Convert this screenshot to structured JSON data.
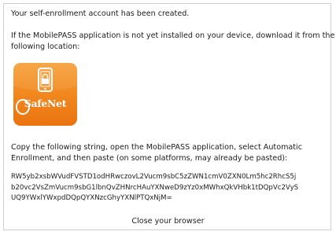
{
  "messages": {
    "created": "Your self-enrollment account has been created.",
    "install_line1": "If the MobilePASS application is not yet installed on your device, download it from the",
    "install_line2": "following location:",
    "copy_line1": "Copy the following string, open the MobilePASS application, select Automatic",
    "copy_line2": "Enrollment, and then paste (on some platforms, may already be pasted):"
  },
  "app_icon": {
    "brand_text": "SafeNet",
    "icon": "mobile-phone-lock-icon",
    "colors": {
      "top": "#f7a039",
      "bottom": "#ea7310",
      "glyph": "#ffffff"
    }
  },
  "enrollment_string": {
    "line1": "RW5yb2xsbWVudFVSTD1odHRwczovL2Vucm9sbC5zZWN1cmV0ZXN0Lm5hc2RhcS5j",
    "line2": "b20vc2VsZmVucm9sbG1lbnQvZHNrcHAuYXNweD9zYz0xMWhxQkVHbk1tDQpVc2VyS",
    "line3": "UQ9YWxlYWxpdDQpQYXNzcGhyYXNlPTQxNjM="
  },
  "actions": {
    "close_label": "Close your browser"
  }
}
